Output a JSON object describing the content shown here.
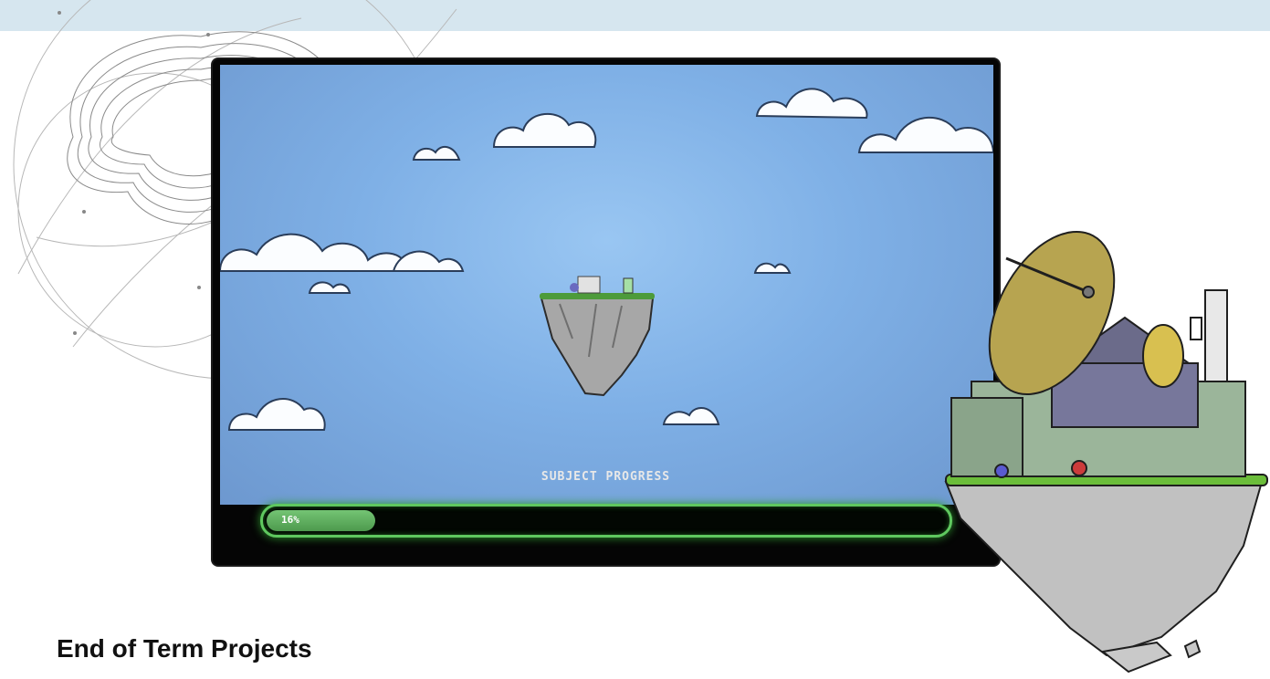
{
  "banner": {
    "color": "#d6e6ef"
  },
  "game": {
    "progress_title": "SUBJECT PROGRESS",
    "progress_percent_label": "16%",
    "progress_fraction": 0.16,
    "sky_color": "#7fb0e6",
    "bar_color": "#5fc85f"
  },
  "section": {
    "heading": "End of Term Projects"
  },
  "icons": [
    "brain-illustration",
    "floating-island-icon",
    "satellite-island-illustration",
    "cloud-icon"
  ]
}
